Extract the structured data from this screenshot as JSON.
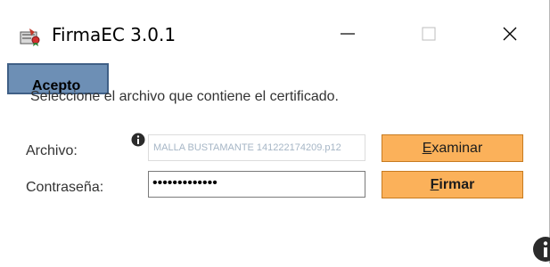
{
  "window": {
    "title": "FirmaEC 3.0.1",
    "controls": {
      "minimize_icon": "minimize-icon",
      "maximize_icon": "maximize-icon",
      "close_icon": "close-icon"
    }
  },
  "overlay_button": {
    "label": "Acepto"
  },
  "form": {
    "instruction": "Seleccione el archivo que contiene el certificado.",
    "file_label": "Archivo:",
    "file_value": "MALLA BUSTAMANTE 141222174209.p12",
    "password_label": "Contraseña:",
    "password_mask": "•••••••••••••",
    "browse_button": {
      "mnemonic": "E",
      "rest": "xaminar"
    },
    "sign_button": {
      "mnemonic": "F",
      "rest": "irmar"
    }
  },
  "icons": {
    "app": "app-certificate-icon",
    "info_small": "info-icon",
    "info_big": "info-icon"
  },
  "colors": {
    "button_orange": "#fbb15a",
    "overlay_button": "#6d8fb5",
    "file_text": "#a6b6c6"
  }
}
